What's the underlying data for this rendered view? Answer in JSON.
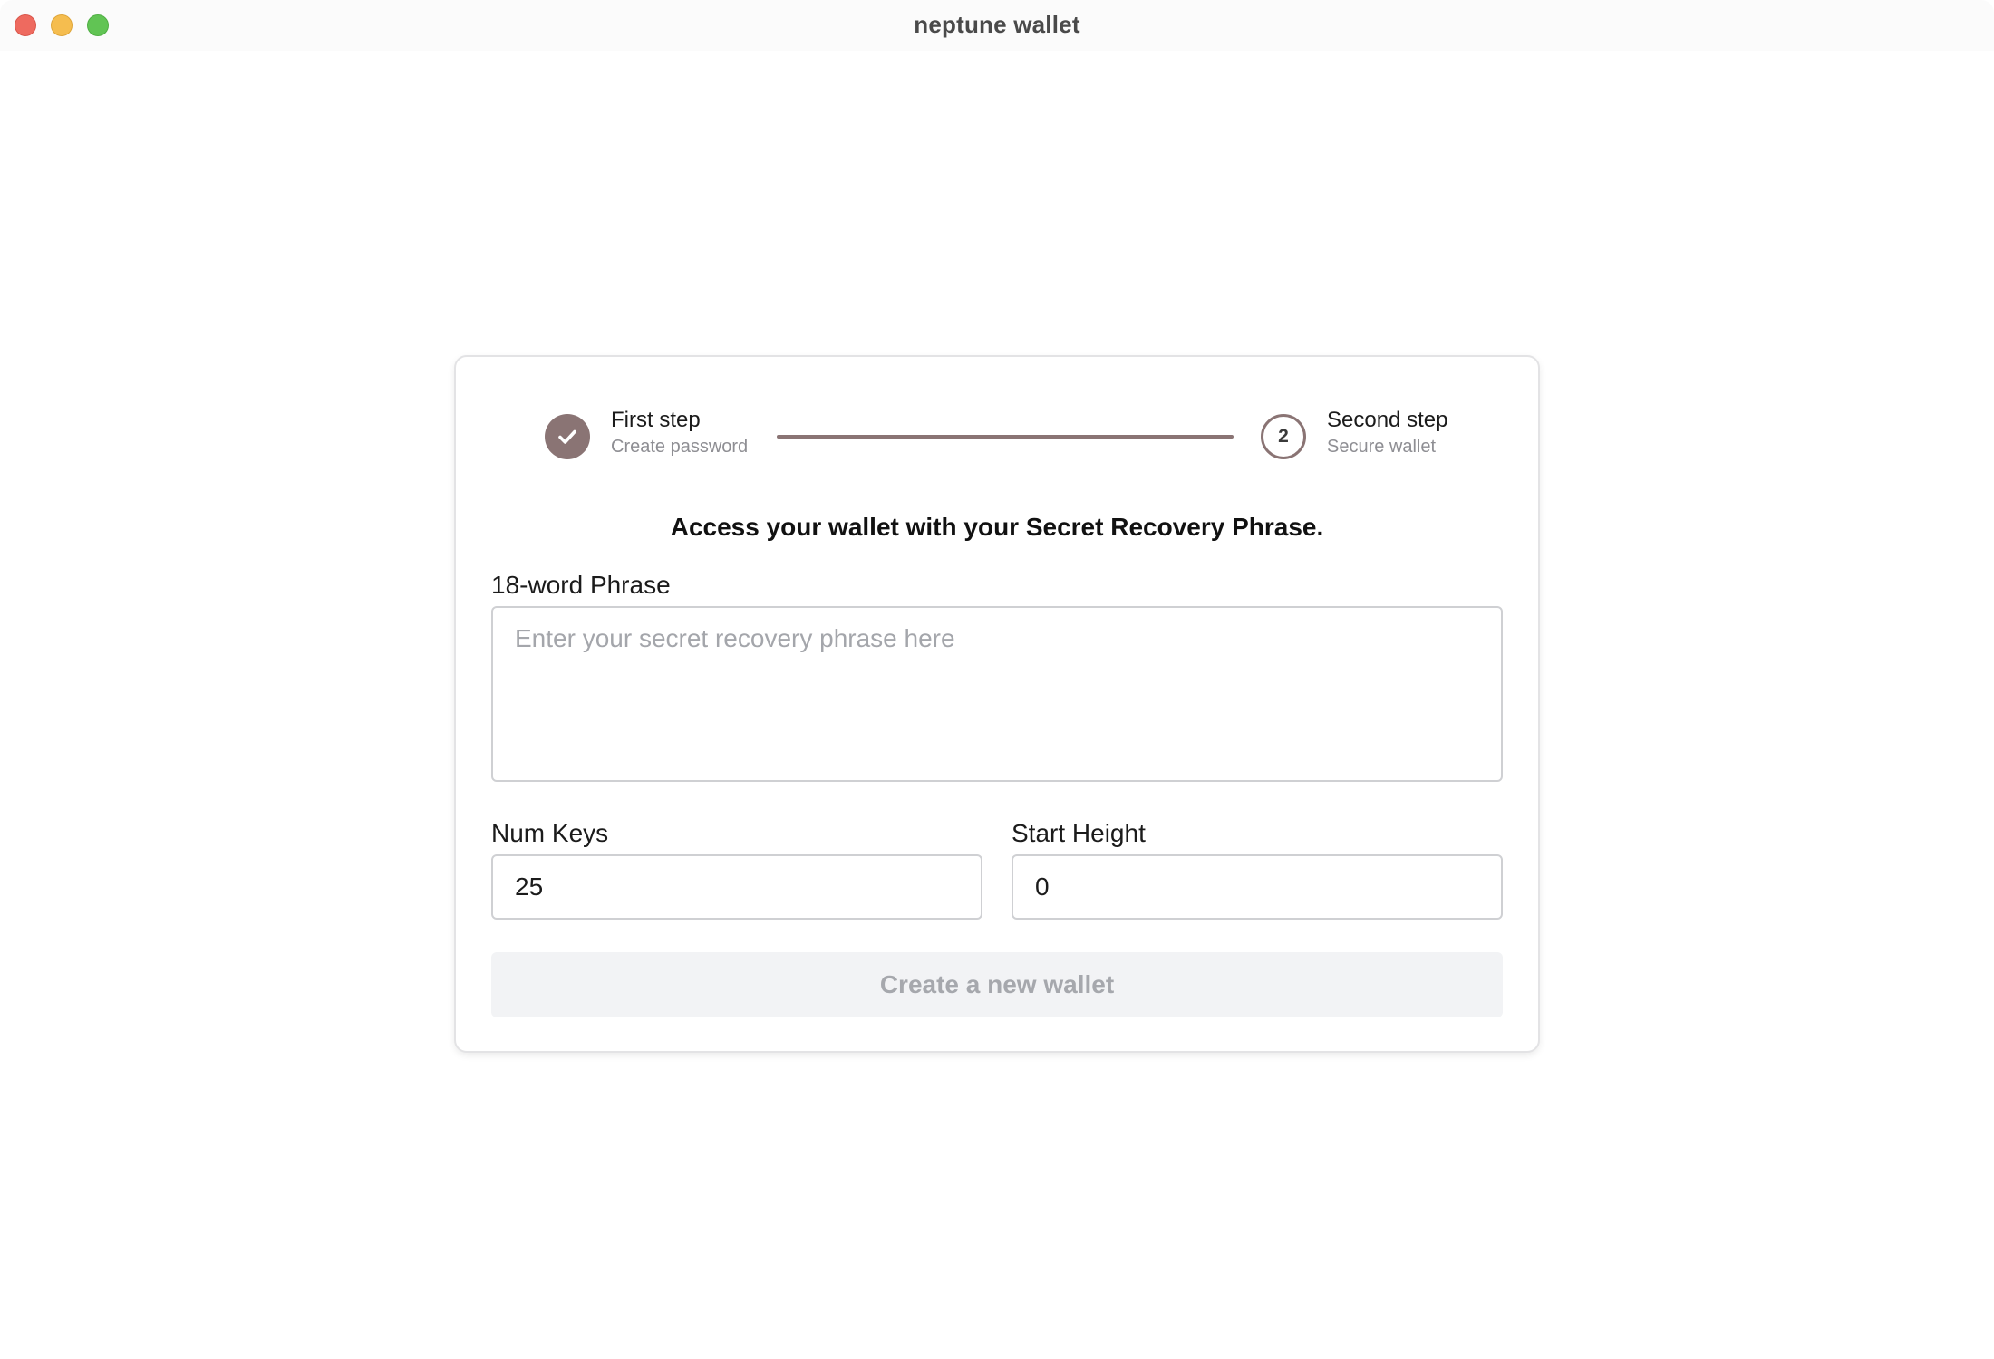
{
  "window": {
    "title": "neptune wallet"
  },
  "stepper": {
    "steps": [
      {
        "title": "First step",
        "subtitle": "Create password",
        "state": "completed",
        "icon": "check-icon"
      },
      {
        "title": "Second step",
        "subtitle": "Secure wallet",
        "state": "active",
        "number": "2"
      }
    ]
  },
  "form": {
    "headline": "Access your wallet with your Secret Recovery Phrase.",
    "phrase": {
      "label": "18-word Phrase",
      "placeholder": "Enter your secret recovery phrase here",
      "value": ""
    },
    "num_keys": {
      "label": "Num Keys",
      "value": "25"
    },
    "start_height": {
      "label": "Start Height",
      "value": "0"
    },
    "submit_label": "Create a new wallet",
    "submit_disabled": true
  },
  "colors": {
    "accent": "#8a7474",
    "button_disabled_bg": "#f2f3f5",
    "button_disabled_text": "#a6a8ad",
    "close": "#ee6a5f",
    "minimize": "#f5bd4f",
    "maximize": "#61c454"
  }
}
